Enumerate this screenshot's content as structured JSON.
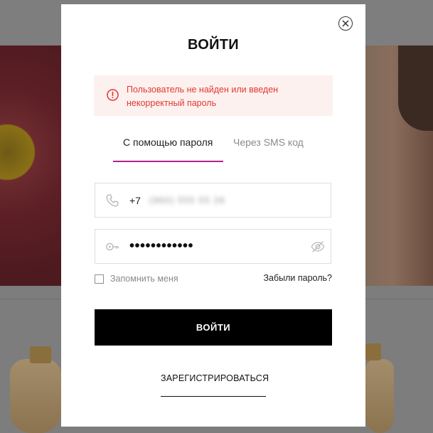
{
  "modal": {
    "title": "ВОЙТИ",
    "close_icon": "close-circle-icon",
    "error": {
      "icon": "exclamation-circle-icon",
      "line1": "Пользователь не найден или введен",
      "line2": "некорректный пароль",
      "color": "#e0392f",
      "background": "#fdf1ef"
    },
    "tabs": [
      {
        "label": "С помощью пароля",
        "active": true
      },
      {
        "label": "Через SMS код",
        "active": false
      }
    ],
    "tab_accent": "#b0218f",
    "phone": {
      "icon": "phone-icon",
      "prefix": "+7",
      "value": "(960) 555 55 26"
    },
    "password": {
      "icon": "key-icon",
      "value": "••••••••••••",
      "toggle_icon": "eye-off-icon"
    },
    "remember_label": "Запомнить меня",
    "forgot_label": "Забыли пароль?",
    "submit_label": "ВОЙТИ",
    "register_label": "ЗАРЕГИСТРИРОВАТЬСЯ"
  }
}
